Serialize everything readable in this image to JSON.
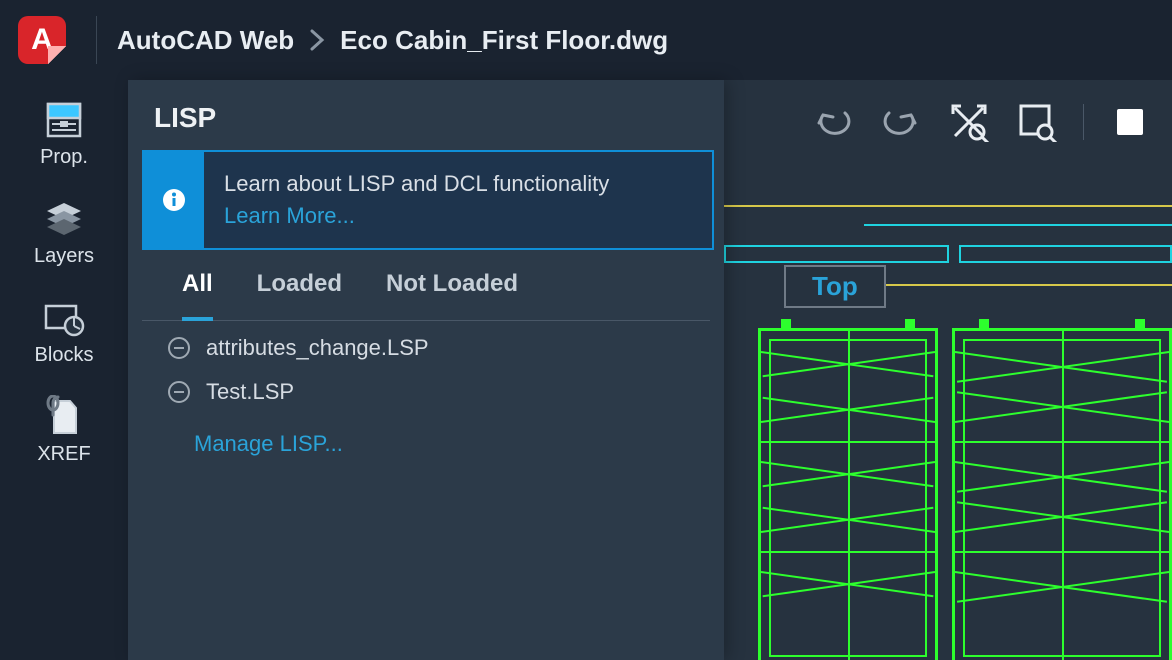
{
  "header": {
    "app_name": "AutoCAD Web",
    "file_name": "Eco Cabin_First Floor.dwg"
  },
  "left_rail": [
    {
      "label": "Prop.",
      "icon": "properties-icon"
    },
    {
      "label": "Layers",
      "icon": "layers-icon"
    },
    {
      "label": "Blocks",
      "icon": "blocks-icon"
    },
    {
      "label": "XREF",
      "icon": "xref-icon"
    }
  ],
  "lisp_panel": {
    "title": "LISP",
    "info_text": "Learn about LISP and DCL functionality",
    "info_link": "Learn More...",
    "tabs": [
      "All",
      "Loaded",
      "Not Loaded"
    ],
    "active_tab": "All",
    "files": [
      "attributes_change.LSP",
      "Test.LSP"
    ],
    "manage_link": "Manage LISP..."
  },
  "canvas": {
    "view_label": "Top",
    "toolbar_icons": [
      "undo-icon",
      "redo-icon",
      "zoom-extents-icon",
      "zoom-window-icon",
      "layout-icon"
    ]
  },
  "colors": {
    "accent": "#0f8fd8",
    "link": "#2aa3d9",
    "panel": "#2c3a49",
    "bg": "#1a2330",
    "yellow": "#d6c84a",
    "cyan": "#1fd3e0",
    "green": "#2dff2d"
  }
}
